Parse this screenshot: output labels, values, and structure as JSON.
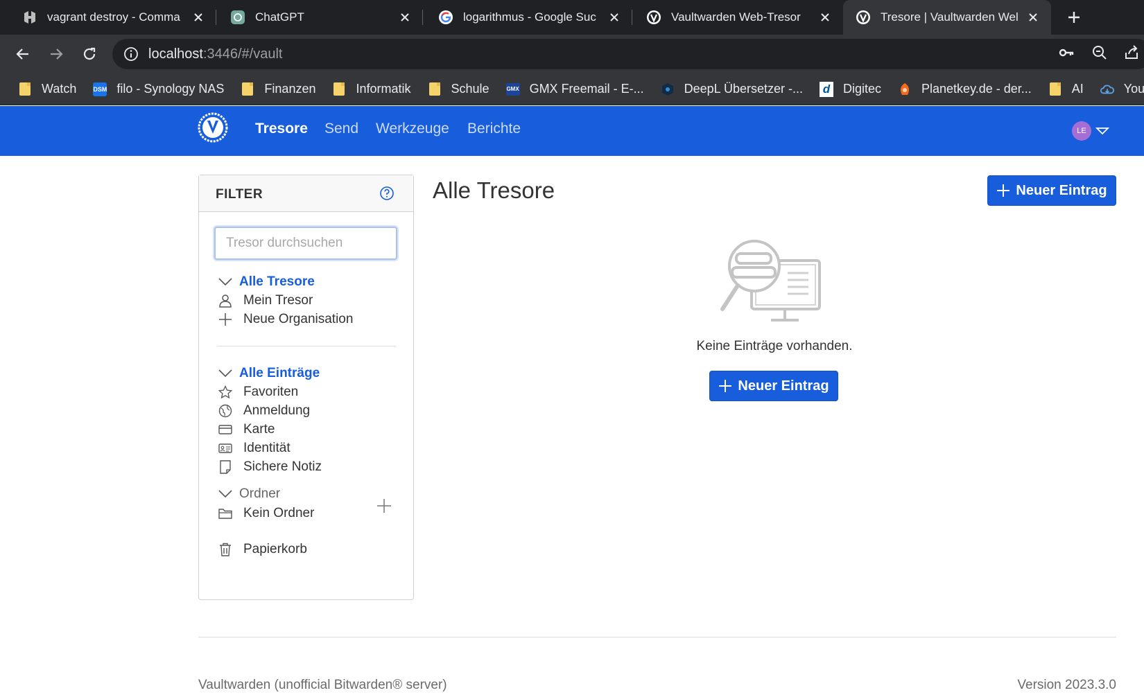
{
  "browser": {
    "tabs": [
      {
        "title": "vagrant destroy - Comma",
        "favicon": "hashicorp-icon"
      },
      {
        "title": "ChatGPT",
        "favicon": "chatgpt-icon"
      },
      {
        "title": "logarithmus - Google Suc",
        "favicon": "google-icon"
      },
      {
        "title": "Vaultwarden Web-Tresor",
        "favicon": "vaultwarden-icon"
      },
      {
        "title": "Tresore | Vaultwarden Wel",
        "favicon": "vaultwarden-icon",
        "active": true
      }
    ],
    "url_host": "localhost",
    "url_path": ":3446/#/vault",
    "bookmarks": [
      {
        "label": "Watch",
        "icon": "folder-icon"
      },
      {
        "label": "filo - Synology NAS",
        "icon": "dsm-icon",
        "badge": "DSM"
      },
      {
        "label": "Finanzen",
        "icon": "folder-icon"
      },
      {
        "label": "Informatik",
        "icon": "folder-icon"
      },
      {
        "label": "Schule",
        "icon": "folder-icon"
      },
      {
        "label": "GMX Freemail - E-...",
        "icon": "gmx-icon",
        "badge": "GMX"
      },
      {
        "label": "DeepL Übersetzer -...",
        "icon": "deepl-icon"
      },
      {
        "label": "Digitec",
        "icon": "digitec-icon",
        "badge": "d"
      },
      {
        "label": "Planetkey.de - der...",
        "icon": "planetkey-icon"
      },
      {
        "label": "AI",
        "icon": "folder-icon"
      },
      {
        "label": "You",
        "icon": "cloud-icon"
      }
    ]
  },
  "app": {
    "nav": {
      "items": [
        "Tresore",
        "Send",
        "Werkzeuge",
        "Berichte"
      ],
      "avatar_initials": "LE"
    },
    "filter": {
      "title": "FILTER",
      "search_placeholder": "Tresor durchsuchen",
      "vaults_heading": "Alle Tresore",
      "my_vault": "Mein Tresor",
      "new_org": "Neue Organisation",
      "items_heading": "Alle Einträge",
      "types": [
        "Favoriten",
        "Anmeldung",
        "Karte",
        "Identität",
        "Sichere Notiz"
      ],
      "folders_heading": "Ordner",
      "no_folder": "Kein Ordner",
      "trash": "Papierkorb"
    },
    "main": {
      "title": "Alle Tresore",
      "new_item_button": "Neuer Eintrag",
      "empty_text": "Keine Einträge vorhanden.",
      "empty_button": "Neuer Eintrag"
    },
    "footer": {
      "left": "Vaultwarden (unofficial Bitwarden® server)",
      "right": "Version 2023.3.0"
    },
    "colors": {
      "primary": "#175ddc",
      "avatar": "#a56ed4"
    }
  }
}
